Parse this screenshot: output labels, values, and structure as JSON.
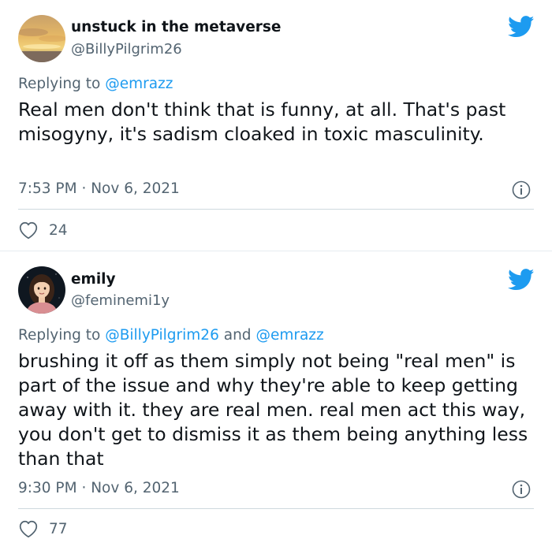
{
  "tweets": [
    {
      "author": {
        "display_name": "unstuck in the metaverse",
        "handle": "@BillyPilgrim26",
        "avatar_icon": "sunset-sky-avatar"
      },
      "replying_to_label": "Replying to",
      "replying_to_mentions": "@emrazz",
      "replying_to_joiner": "",
      "replying_to_mentions_2": "",
      "text": "Real men don't think that is funny, at all. That's past misogyny, it's sadism cloaked in toxic masculinity.",
      "time": "7:53 PM",
      "separator": "·",
      "date": "Nov 6, 2021",
      "likes": "24"
    },
    {
      "author": {
        "display_name": "emily",
        "handle": "@feminemi1y",
        "avatar_icon": "cartoon-girl-avatar"
      },
      "replying_to_label": "Replying to",
      "replying_to_mentions": "@BillyPilgrim26",
      "replying_to_joiner": "and",
      "replying_to_mentions_2": "@emrazz",
      "text": "brushing it off as them simply not being \"real men\" is part of the issue and why they're able to keep getting away with it. they are real men. real men act this way, you don't get to dismiss it as them being anything less than that",
      "time": "9:30 PM",
      "separator": "·",
      "date": "Nov 6, 2021",
      "likes": "77"
    }
  ],
  "icons": {
    "brand": "twitter-bird-icon",
    "info": "info-icon",
    "like": "heart-icon"
  },
  "colors": {
    "brand_blue": "#1d9bf0",
    "secondary_text": "#536471",
    "primary_text": "#0f1419",
    "divider": "#cfd9de"
  }
}
